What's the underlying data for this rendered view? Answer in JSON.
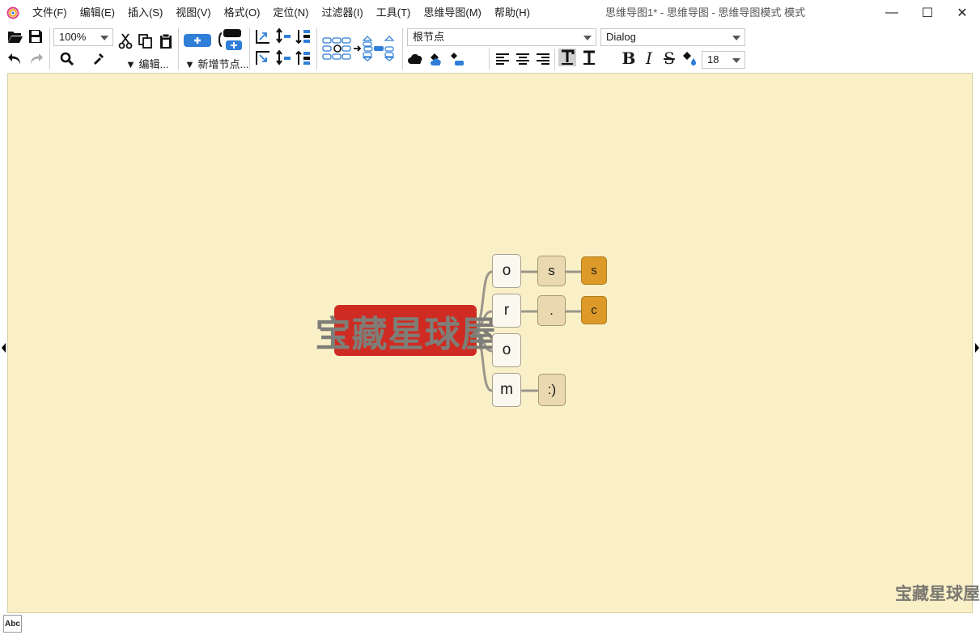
{
  "window": {
    "title": "思维导图1* - 思维导图 - 思维导图模式 模式",
    "controls": {
      "minimize": "—",
      "maximize": "☐",
      "close": "✕"
    }
  },
  "menu": [
    {
      "label": "文件(F)"
    },
    {
      "label": "编辑(E)"
    },
    {
      "label": "插入(S)"
    },
    {
      "label": "视图(V)"
    },
    {
      "label": "格式(O)"
    },
    {
      "label": "定位(N)"
    },
    {
      "label": "过滤器(I)"
    },
    {
      "label": "工具(T)"
    },
    {
      "label": "思维导图(M)"
    },
    {
      "label": "帮助(H)"
    }
  ],
  "toolbar": {
    "zoom_value": "100%",
    "edit_label": "▼ 编辑...",
    "new_node_label": "▼ 新增节点...",
    "style_value": "根节点",
    "font_value": "Dialog",
    "font_size_value": "18",
    "bold": "B",
    "italic": "I",
    "strike": "S"
  },
  "map": {
    "root": "宝藏星球屋",
    "level1": [
      "o",
      "r",
      "o",
      "m"
    ],
    "level2": [
      "s",
      ".",
      ":)"
    ],
    "level3": [
      "s",
      "c"
    ]
  },
  "watermark": "宝藏星球屋",
  "status": {
    "spell_label": "Abc"
  },
  "colors": {
    "canvas_bg": "#faf0c8",
    "root_bg": "#d02b22",
    "node_beige": "#ead9b0",
    "node_orange": "#dd9a28",
    "toolbar_blue": "#2f7ed8"
  }
}
